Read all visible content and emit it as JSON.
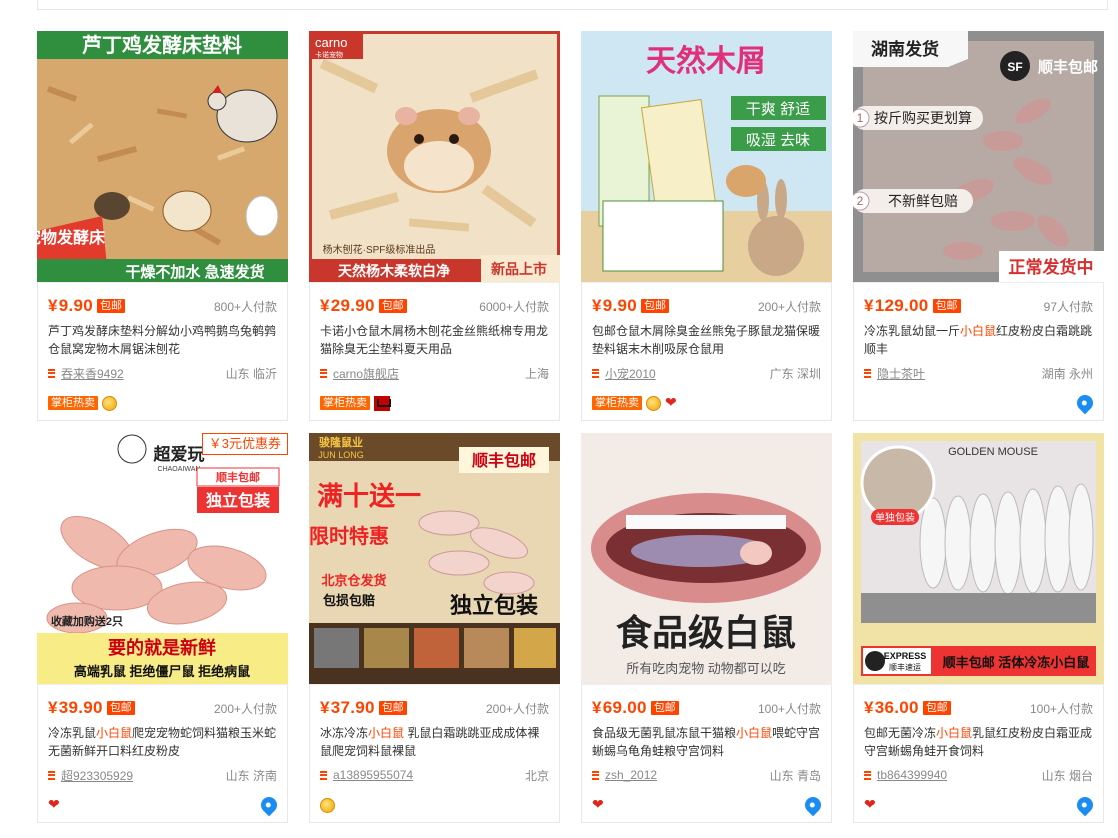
{
  "products": [
    {
      "img_headline": "芦丁鸡发酵床垫料",
      "img_badge": "宠物发酵床",
      "img_footer": "干燥不加水 急速发货",
      "price": "9.90",
      "baoyou": "包邮",
      "paid": "800+人付款",
      "title_a": "芦丁鸡发酵床垫料分解幼小鸡鸭鹅鸟兔鹌鹑仓鼠窝宠物木屑锯沫刨花",
      "title_hl": "",
      "title_b": "",
      "shop": "吞来香9492",
      "location": "山东 临沂",
      "badges": [
        "zgrm",
        "medal"
      ],
      "zgrm_label": "掌柜热卖"
    },
    {
      "img_brand": "carno",
      "img_brand_cn": "卡诺宠物",
      "img_sub": "杨木刨花·SPF级标准出品",
      "img_footer": "天然杨木柔软白净",
      "img_new": "新品上市",
      "price": "29.90",
      "baoyou": "包邮",
      "paid": "6000+人付款",
      "title_a": "卡诺小仓鼠木屑杨木刨花金丝熊纸棉专用龙猫除臭无尘垫料夏天用品",
      "title_hl": "",
      "title_b": "",
      "shop": "carno旗舰店",
      "location": "上海",
      "badges": [
        "zgrm",
        "tmall"
      ],
      "zgrm_label": "掌柜热卖"
    },
    {
      "img_headline": "天然木屑",
      "img_tag1": "干爽 舒适",
      "img_tag2": "吸湿 去味",
      "price": "9.90",
      "baoyou": "包邮",
      "paid": "200+人付款",
      "title_a": "包邮仓鼠木屑除臭金丝熊兔子豚鼠龙猫保暖垫料锯末木削吸尿仓鼠用",
      "title_hl": "",
      "title_b": "",
      "shop": "小宠2010",
      "location": "广东 深圳",
      "badges": [
        "zgrm",
        "medal",
        "heart"
      ],
      "zgrm_label": "掌柜热卖"
    },
    {
      "img_headline": "湖南发货",
      "img_sf": "顺丰包邮",
      "img_tag1": "按斤购买更划算",
      "img_tag2": "不新鲜包赔",
      "img_footer": "正常发货中",
      "price": "129.00",
      "baoyou": "包邮",
      "paid": "97人付款",
      "title_a": "冷冻乳鼠幼鼠一斤",
      "title_hl": "小白鼠",
      "title_b": "红皮粉皮白霜跳跳顺丰",
      "shop": "隐士茶叶",
      "location": "湖南 永州",
      "badges": [
        "drop"
      ]
    },
    {
      "img_brand": "超爱玩",
      "img_brand_en": "CHAOAIWAN",
      "img_coupon": "￥3元优惠券",
      "img_tag1": "顺丰包邮",
      "img_tag2": "独立包装",
      "img_tag3": "收藏加购送2只",
      "img_footer1": "要的就是新鲜",
      "img_footer2": "高端乳鼠  拒绝僵尸鼠  拒绝病鼠",
      "price": "39.90",
      "baoyou": "包邮",
      "paid": "200+人付款",
      "title_a": "冷冻乳鼠",
      "title_hl": "小白鼠",
      "title_b": "爬宠宠物蛇饲料猫粮玉米蛇无菌新鲜开口料红皮粉皮",
      "shop": "超923305929",
      "location": "山东 济南",
      "badges": [
        "heart",
        "drop"
      ]
    },
    {
      "img_brand": "骏隆鼠业",
      "img_brand_en": "JUN LONG",
      "img_tag1": "顺丰包邮",
      "img_tag2": "满十送一",
      "img_tag3": "限时特惠",
      "img_tag4": "北京仓发货",
      "img_tag5": "包损包赔",
      "img_tag6": "独立包装",
      "price": "37.90",
      "baoyou": "包邮",
      "paid": "200+人付款",
      "title_a": "冰冻冷冻",
      "title_hl": "小白鼠",
      "title_b": " 乳鼠白霜跳跳亚成成体裸鼠爬宠饲料鼠裸鼠",
      "shop": "a13895955074",
      "location": "北京",
      "badges": [
        "medal"
      ]
    },
    {
      "img_headline": "食品级白鼠",
      "img_sub": "所有吃肉宠物 动物都可以吃",
      "price": "69.00",
      "baoyou": "包邮",
      "paid": "100+人付款",
      "title_a": "食品级无菌乳鼠冻鼠干猫粮",
      "title_hl": "小白鼠",
      "title_b": "喂蛇守宫蜥蜴乌龟角蛙粮守宫饲料",
      "shop": "zsh_2012",
      "location": "山东 青岛",
      "badges": [
        "heart",
        "drop"
      ]
    },
    {
      "img_headline": "GOLDEN MOUSE",
      "img_tag1": "单独包装",
      "img_sf1": "EXPRESS",
      "img_sf2": "顺丰速运",
      "img_footer": "顺丰包邮  活体冷冻小白鼠",
      "price": "36.00",
      "baoyou": "包邮",
      "paid": "100+人付款",
      "title_a": "包邮无菌冷冻",
      "title_hl": "小白鼠",
      "title_b": "乳鼠红皮粉皮白霜亚成守宫蜥蜴角蛙开食饲料",
      "shop": "tb864399940",
      "location": "山东 烟台",
      "badges": [
        "heart",
        "drop"
      ]
    }
  ]
}
